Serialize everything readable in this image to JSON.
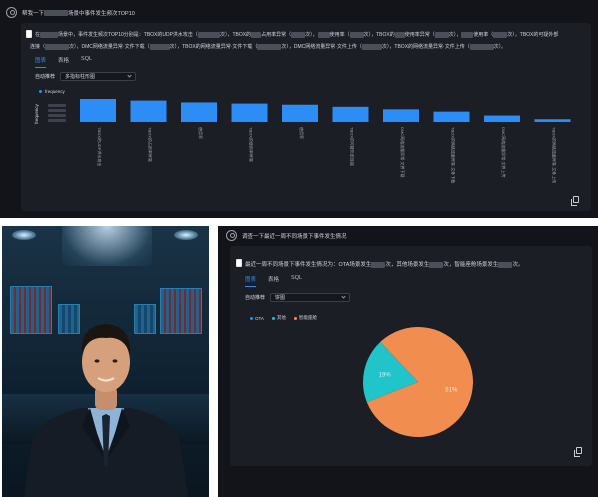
{
  "top": {
    "question": "帮我一下",
    "question_suffix": "场景中事件发生频次TOP10",
    "answer_line1": [
      "在",
      "场景中，事件发生频次TOP10分别是：TBOX的UDP洪水攻击（",
      "次），TBOX的",
      "占用率异常（",
      "次），",
      "使用率（",
      "次），TBOX的",
      "使用率异常（",
      "次），",
      "使用率（",
      "次），TBOX的可疑外部"
    ],
    "answer_line2": [
      "连接（",
      "次），DMC网络流量异常·文件下载（",
      "次），TBOX的网络流量异常·文件下载（",
      "次），DMC网络流量异常·文件上传（",
      "次），TBOX的网络流量异常·文件上传（",
      "次）。"
    ],
    "tabs": [
      "图表",
      "表格",
      "SQL"
    ],
    "active_tab": "图表",
    "recommend_label": "自动推荐",
    "chart_select": "多指标柱形图",
    "legend": "frequency",
    "y_axis_label": "frequency"
  },
  "chart_data": [
    {
      "type": "bar",
      "series": [
        {
          "name": "frequency",
          "values": [
            100,
            93,
            85,
            80,
            75,
            66,
            55,
            45,
            28,
            12
          ]
        }
      ],
      "categories": [
        "TBOX的UDP洪水攻击",
        "TBOX的占用率异常",
        "使用率",
        "TBOX的使用率异常",
        "使用率",
        "TBOX的可疑外部连接",
        "DMC网络流量异常·文件下载",
        "TBOX的网络流量异常·文件下载",
        "DMC网络流量异常·文件上传",
        "TBOX的网络流量异常·文件上传"
      ],
      "color": "#2c8df6"
    },
    {
      "type": "pie",
      "categories": [
        "OTA",
        "其他",
        "智能座舱"
      ],
      "values": [
        0,
        19,
        81
      ],
      "labels": [
        "",
        "19%",
        "81%"
      ],
      "colors": [
        "#2c8df6",
        "#21c4c9",
        "#f08d4f"
      ]
    }
  ],
  "bottom": {
    "question": "调查一下最近一周不同场景下事件发生情况",
    "answer": [
      "最近一周不同场景下事件发生情况为：OTA场景发生",
      "次，其他场景发生",
      "次，智能座舱场景发生",
      "次。"
    ],
    "tabs": [
      "图表",
      "表格",
      "SQL"
    ],
    "active_tab": "图表",
    "recommend_label": "自动推荐",
    "chart_select": "饼图",
    "legend": [
      "OTA",
      "其他",
      "智能座舱"
    ]
  },
  "colors": {
    "accent": "#2b8cf7",
    "panel_bg": "#131419",
    "card_bg": "#1c1e25"
  },
  "icons": [
    "avatar-icon",
    "document-icon",
    "copy-icon",
    "chevron-down-icon"
  ]
}
